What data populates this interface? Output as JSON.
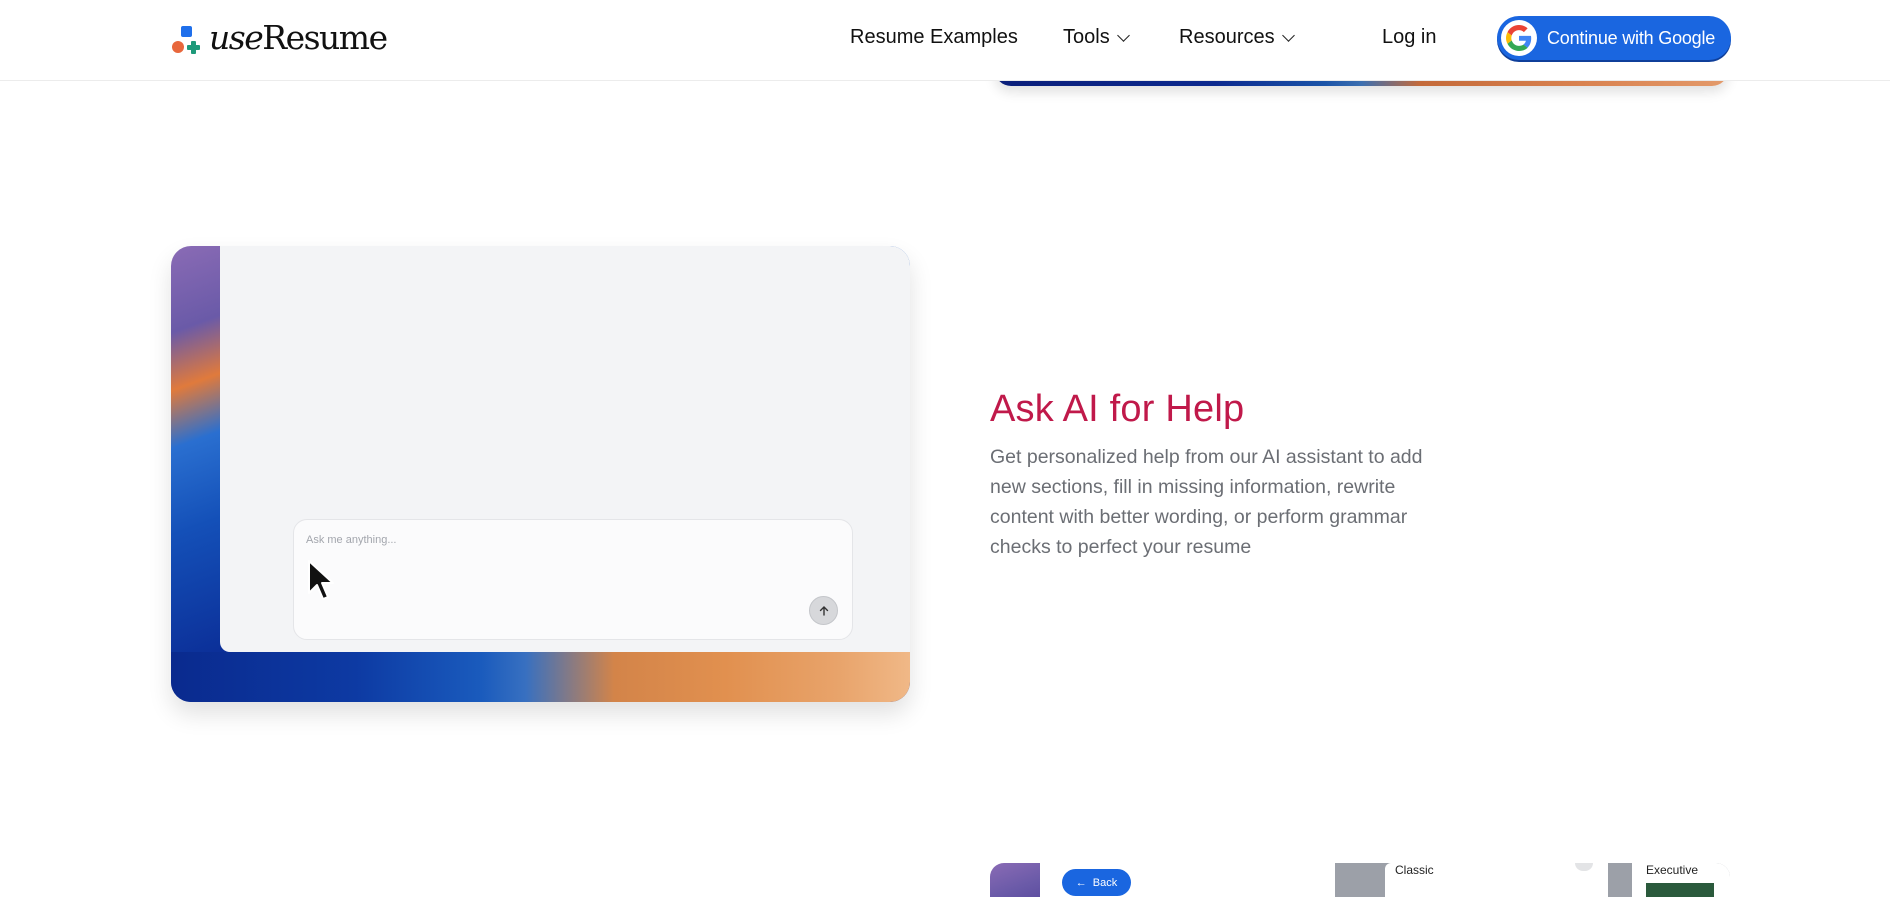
{
  "header": {
    "logo_prefix": "use",
    "logo_suffix": "Resume",
    "nav": {
      "resume_examples": "Resume Examples",
      "tools": "Tools",
      "resources": "Resources",
      "login": "Log in"
    },
    "cta_label": "Continue with Google"
  },
  "feature": {
    "title": "Ask AI for Help",
    "description": "Get personalized help from our AI assistant to add new sections, fill in missing information, rewrite content with better wording, or perform grammar checks to perfect your resume",
    "chat_placeholder": "Ask me anything...",
    "title_color": "#c0194a"
  },
  "next_preview": {
    "back_label": "Back",
    "template_1": "Classic",
    "template_2": "Executive"
  },
  "colors": {
    "brand_blue": "#1a66e0",
    "accent_orange": "#e8673c",
    "accent_green": "#1e9a7a"
  }
}
